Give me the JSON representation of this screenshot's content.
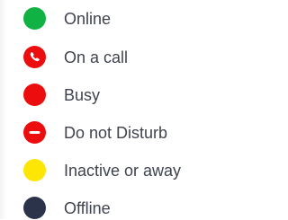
{
  "colors": {
    "online": "#0fb243",
    "on_call": "#ec0e0e",
    "busy": "#ec0e0e",
    "dnd": "#ec0e0e",
    "away": "#fde603",
    "offline": "#2a334a",
    "text": "#3f434f"
  },
  "statuses": [
    {
      "label": "Online",
      "icon": "green-dot-icon"
    },
    {
      "label": "On a call",
      "icon": "phone-icon"
    },
    {
      "label": "Busy",
      "icon": "red-dot-icon"
    },
    {
      "label": "Do not Disturb",
      "icon": "minus-icon"
    },
    {
      "label": "Inactive or away",
      "icon": "yellow-dot-icon"
    },
    {
      "label": "Offline",
      "icon": "navy-dot-icon"
    }
  ]
}
